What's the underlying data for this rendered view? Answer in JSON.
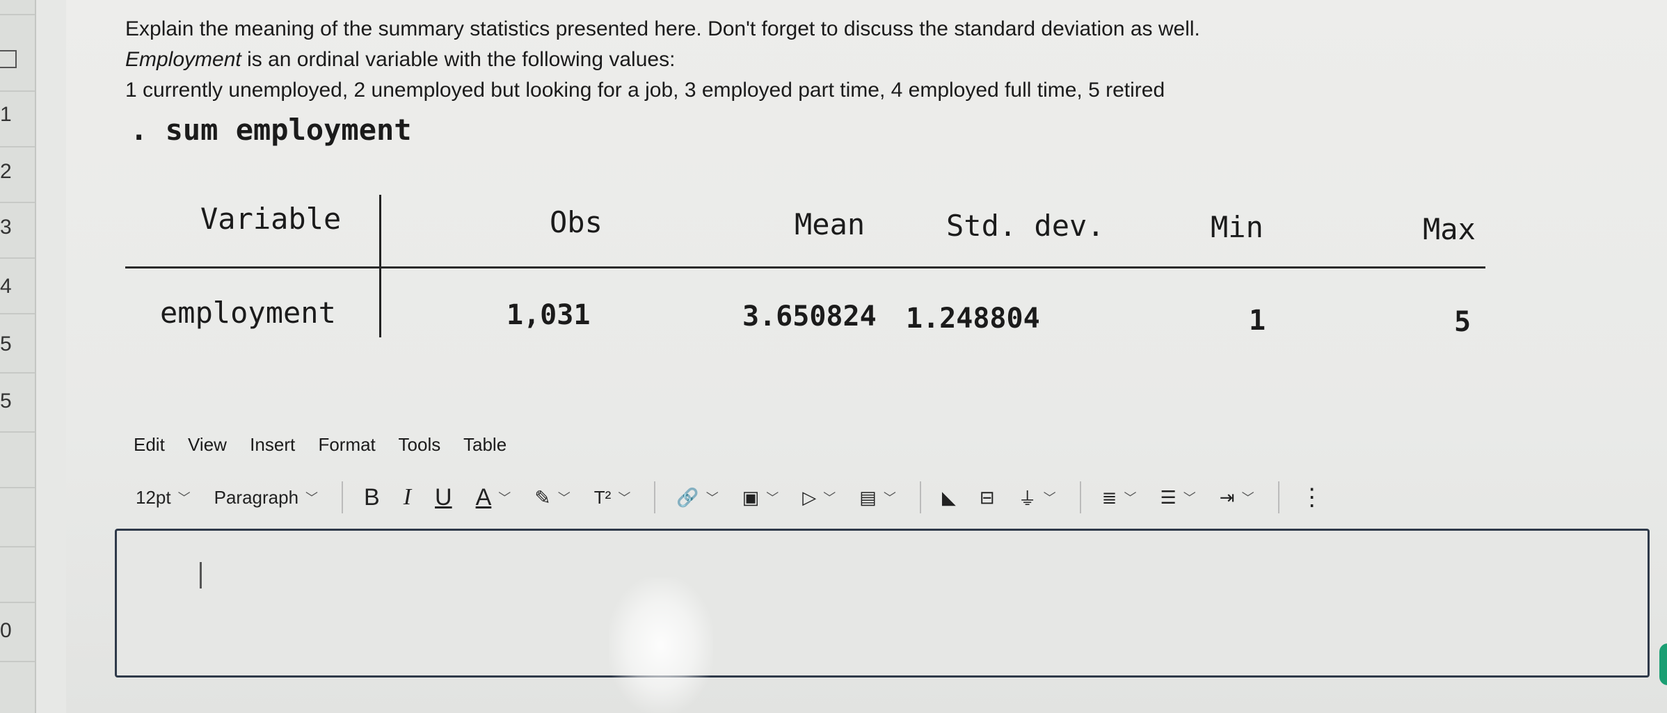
{
  "question": {
    "line1": "Explain the meaning of the summary statistics presented here. Don't forget to discuss the standard deviation as well.",
    "line2_italic": "Employment",
    "line2_rest": " is an ordinal variable with the following values:",
    "line3": "1 currently unemployed, 2 unemployed but looking for a job, 3 employed part time, 4 employed full time, 5 retired"
  },
  "command": ". sum employment",
  "stata_table": {
    "headers": [
      "Variable",
      "Obs",
      "Mean",
      "Std. dev.",
      "Min",
      "Max"
    ],
    "row": [
      "employment",
      "1,031",
      "3.650824",
      "1.248804",
      "1",
      "5"
    ]
  },
  "gutter_numbers": [
    "1",
    "2",
    "3",
    "4",
    "5",
    "5",
    "0"
  ],
  "menu": [
    "Edit",
    "View",
    "Insert",
    "Format",
    "Tools",
    "Table"
  ],
  "toolbar": {
    "font_size": "12pt",
    "block_format": "Paragraph",
    "bold": "B",
    "italic": "I",
    "underline": "U",
    "text_color": "A",
    "superscript": "T²",
    "more": "⋮"
  },
  "grammarly_label": "G",
  "icons": {
    "link": "link-icon",
    "image": "image-icon",
    "media": "media-icon",
    "document": "document-icon",
    "apps": "apps-icon",
    "plugin": "plugin-icon",
    "align": "align-icon",
    "list": "list-icon",
    "indent": "indent-icon"
  },
  "colors": {
    "editor_border": "#2f3a4a",
    "grammarly": "#1a9f73"
  }
}
